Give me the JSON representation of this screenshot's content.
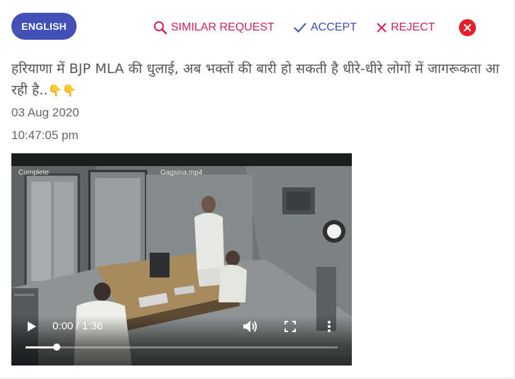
{
  "header": {
    "language_label": "ENGLISH",
    "similar_request_label": "SIMILAR REQUEST",
    "accept_label": "ACCEPT",
    "reject_label": "REJECT"
  },
  "post": {
    "text": "हरियाणा में BJP MLA की धुलाई, अब भक्तों की बारी हो सकती है धीरे-धीरे लोगों में जागरूकता आ रही है..",
    "emoji": "👇👇",
    "date": "03 Aug 2020",
    "time": "10:47:05 pm"
  },
  "video": {
    "overlay_left": "Complete",
    "overlay_filename": "Gagsina.mp4",
    "current_time": "0:00",
    "duration": "1:36",
    "time_display": "0:00 / 1:36",
    "progress_fraction": 0.1
  },
  "colors": {
    "language_bg": "#4350b5",
    "action_pink": "#d21f60",
    "action_blue": "#3f4fb0",
    "close_red": "#e5202a"
  }
}
